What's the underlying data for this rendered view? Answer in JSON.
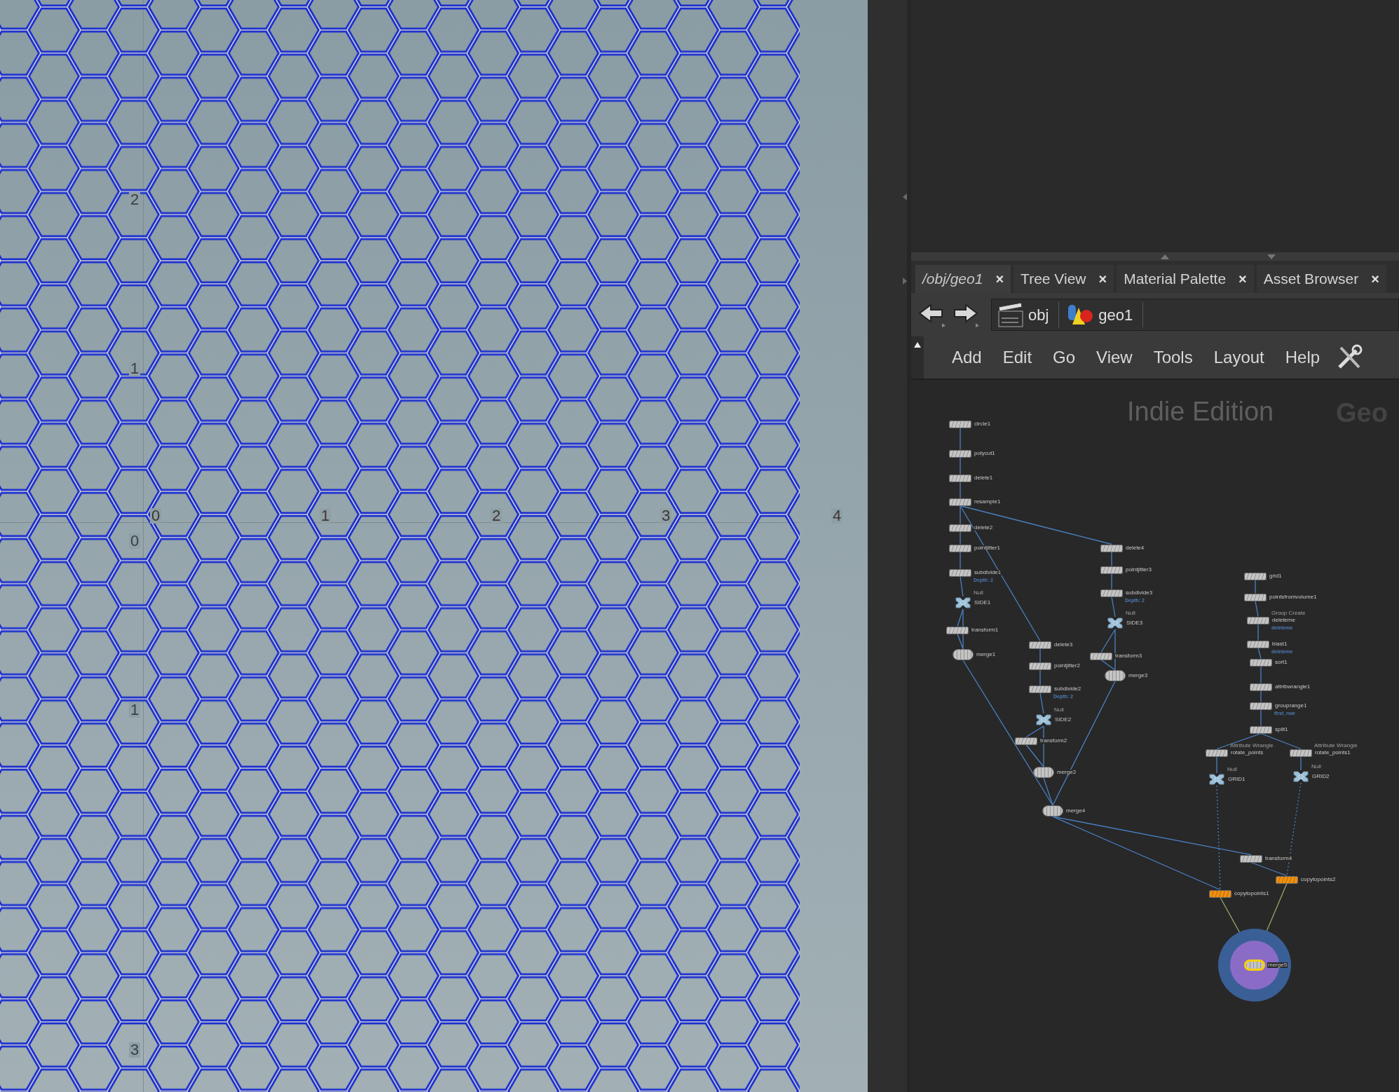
{
  "viewport": {
    "axis_x_labels": [
      "0",
      "1",
      "2",
      "3",
      "4"
    ],
    "axis_y_labels": [
      "2",
      "1",
      "0",
      "1",
      "3"
    ]
  },
  "tabs": [
    {
      "label": "/obj/geo1",
      "selected": true,
      "close": "×"
    },
    {
      "label": "Tree View",
      "selected": false,
      "close": "×"
    },
    {
      "label": "Material Palette",
      "selected": false,
      "close": "×"
    },
    {
      "label": "Asset Browser",
      "selected": false,
      "close": "×"
    }
  ],
  "path": [
    {
      "label": "obj",
      "kind": "obj"
    },
    {
      "label": "geo1",
      "kind": "geo"
    }
  ],
  "menu": [
    "Add",
    "Edit",
    "Go",
    "View",
    "Tools",
    "Layout",
    "Help"
  ],
  "network": {
    "watermark": "Indie Edition",
    "context_label": "Geo",
    "nodes": [
      {
        "name": "circle1",
        "kind": "box",
        "color": "#c4c4c4",
        "selected": false
      },
      {
        "name": "polycut1",
        "kind": "box",
        "color": "#c4c4c4",
        "selected": false
      },
      {
        "name": "delete1",
        "kind": "box",
        "color": "#c4c4c4",
        "selected": false
      },
      {
        "name": "resample1",
        "kind": "box",
        "color": "#c4c4c4",
        "selected": false
      },
      {
        "name": "delete2",
        "kind": "box",
        "color": "#c4c4c4",
        "selected": false
      },
      {
        "name": "pointjitter1",
        "kind": "box",
        "color": "#c4c4c4",
        "selected": false
      },
      {
        "name": "subdivide1",
        "kind": "box",
        "color": "#c4c4c4",
        "selected": false,
        "note": "Depth: 2"
      },
      {
        "name": "SIDE1",
        "kind": "null",
        "color": "#9cc0d8",
        "selected": false,
        "type_label": "Null"
      },
      {
        "name": "transform1",
        "kind": "box",
        "color": "#c4c4c4",
        "selected": false
      },
      {
        "name": "merge1",
        "kind": "merge",
        "color": "#c4c4c4",
        "selected": false
      },
      {
        "name": "delete3",
        "kind": "box",
        "color": "#c4c4c4",
        "selected": false
      },
      {
        "name": "pointjitter2",
        "kind": "box",
        "color": "#c4c4c4",
        "selected": false
      },
      {
        "name": "subdivide2",
        "kind": "box",
        "color": "#c4c4c4",
        "selected": false,
        "note": "Depth: 2"
      },
      {
        "name": "SIDE2",
        "kind": "null",
        "color": "#9cc0d8",
        "selected": false,
        "type_label": "Null"
      },
      {
        "name": "transform2",
        "kind": "box",
        "color": "#c4c4c4",
        "selected": false
      },
      {
        "name": "merge2",
        "kind": "merge",
        "color": "#c4c4c4",
        "selected": false
      },
      {
        "name": "merge4",
        "kind": "merge",
        "color": "#c4c4c4",
        "selected": false
      },
      {
        "name": "delete4",
        "kind": "box",
        "color": "#c4c4c4",
        "selected": false
      },
      {
        "name": "pointjitter3",
        "kind": "box",
        "color": "#c4c4c4",
        "selected": false
      },
      {
        "name": "subdivide3",
        "kind": "box",
        "color": "#c4c4c4",
        "selected": false,
        "note": "Depth: 2"
      },
      {
        "name": "SIDE3",
        "kind": "null",
        "color": "#9cc0d8",
        "selected": false,
        "type_label": "Null"
      },
      {
        "name": "transform3",
        "kind": "box",
        "color": "#c4c4c4",
        "selected": false
      },
      {
        "name": "merge3",
        "kind": "merge",
        "color": "#c4c4c4",
        "selected": false
      },
      {
        "name": "grid1",
        "kind": "box",
        "color": "#c4c4c4",
        "selected": false
      },
      {
        "name": "pointsfromvolume1",
        "kind": "box",
        "color": "#c4c4c4",
        "selected": false
      },
      {
        "name": "deleteme",
        "kind": "box",
        "color": "#c4c4c4",
        "selected": false,
        "type_label": "Group Create",
        "note": "deleteme"
      },
      {
        "name": "blast1",
        "kind": "box",
        "color": "#c4c4c4",
        "selected": false,
        "note": "deleteme"
      },
      {
        "name": "sort1",
        "kind": "box",
        "color": "#c4c4c4",
        "selected": false
      },
      {
        "name": "attribwrangle1",
        "kind": "box",
        "color": "#c4c4c4",
        "selected": false
      },
      {
        "name": "grouprange1",
        "kind": "box",
        "color": "#c4c4c4",
        "selected": false,
        "note": "first_row"
      },
      {
        "name": "split1",
        "kind": "box",
        "color": "#c4c4c4",
        "selected": false
      },
      {
        "name": "rotate_points",
        "kind": "box",
        "color": "#c4c4c4",
        "selected": false,
        "type_label": "Attribute Wrangle"
      },
      {
        "name": "rotate_points1",
        "kind": "box",
        "color": "#c4c4c4",
        "selected": false,
        "type_label": "Attribute Wrangle"
      },
      {
        "name": "GRID1",
        "kind": "null",
        "color": "#9cc0d8",
        "selected": false,
        "type_label": "Null"
      },
      {
        "name": "GRID2",
        "kind": "null",
        "color": "#9cc0d8",
        "selected": false,
        "type_label": "Null"
      },
      {
        "name": "transform4",
        "kind": "box",
        "color": "#c4c4c4",
        "selected": false
      },
      {
        "name": "copytopoints1",
        "kind": "box",
        "color": "#f0900f",
        "selected": false
      },
      {
        "name": "copytopoints2",
        "kind": "box",
        "color": "#f0900f",
        "selected": false
      },
      {
        "name": "merge5",
        "kind": "merge",
        "color": "#c4c4c4",
        "selected": true
      }
    ]
  }
}
